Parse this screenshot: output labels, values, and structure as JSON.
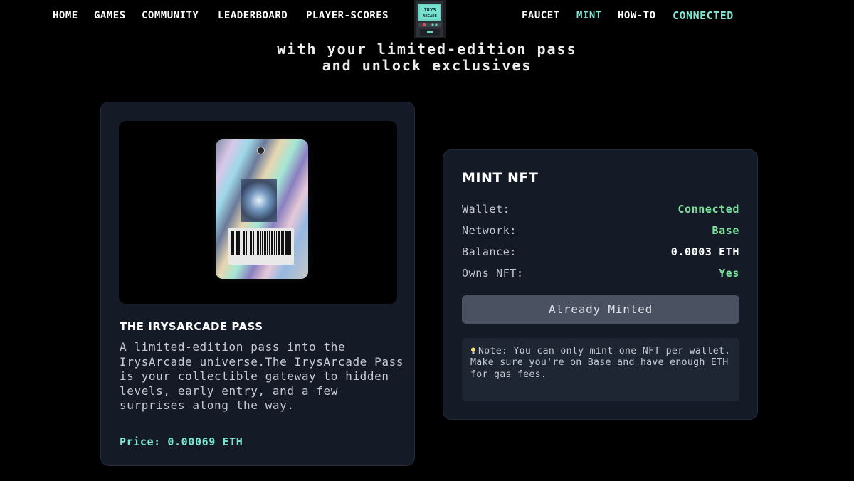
{
  "nav": {
    "home": "HOME",
    "games": "GAMES",
    "community": "COMMUNITY",
    "leaderboard": "LEADERBOARD",
    "player_scores": "PLAYER-SCORES",
    "faucet": "FAUCET",
    "mint": "MINT",
    "how_to": "HOW-TO",
    "connected": "CONNECTED",
    "logo_icon": "arcade-cabinet-icon"
  },
  "hero": {
    "line1": "with your limited-edition pass",
    "line2": "and unlock exclusives"
  },
  "pass_card": {
    "title": "THE IRYSARCADE PASS",
    "description": "A limited-edition pass into the IrysArcade universe.The IrysArcade Pass is your collectible gateway to hidden levels, early entry, and a few surprises along the way.",
    "price": "Price: 0.00069 ETH"
  },
  "mint_card": {
    "title": "MINT NFT",
    "rows": [
      {
        "label": "Wallet:",
        "value": "Connected"
      },
      {
        "label": "Network:",
        "value": "Base"
      },
      {
        "label": "Balance:",
        "value": "0.0003 ETH"
      },
      {
        "label": "Owns NFT:",
        "value": "Yes"
      }
    ],
    "button": "Already Minted",
    "note": "Note: You can only mint one NFT per wallet. Make sure you're on Base and have enough ETH for gas fees."
  },
  "colors": {
    "accent": "#7ee6d3",
    "status_green": "#7be29a",
    "card_bg": "#141a26",
    "button_bg": "#4a5262"
  }
}
